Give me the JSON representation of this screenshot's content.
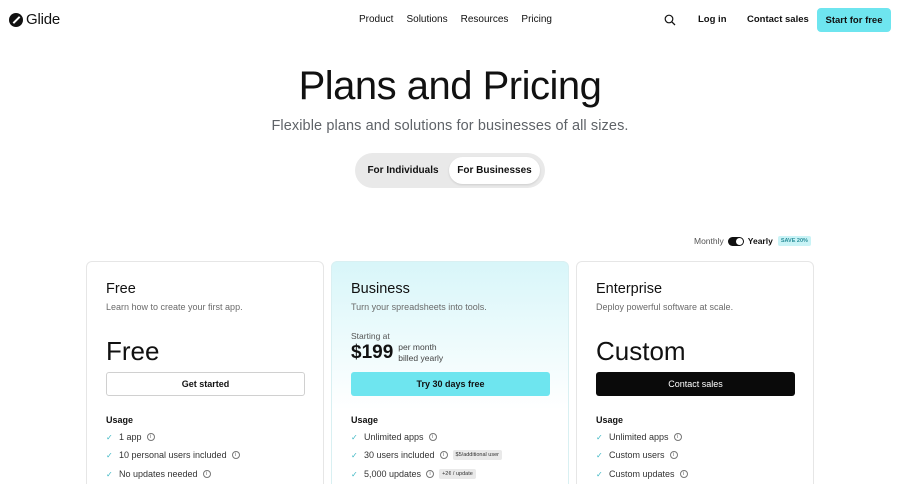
{
  "brand": {
    "name": "Glide"
  },
  "nav": {
    "links": [
      "Product",
      "Solutions",
      "Resources",
      "Pricing"
    ],
    "login": "Log in",
    "contact": "Contact sales",
    "cta": "Start for free"
  },
  "hero": {
    "title": "Plans and Pricing",
    "subtitle": "Flexible plans and solutions for businesses of all sizes."
  },
  "segment": {
    "individuals": "For Individuals",
    "businesses": "For Businesses",
    "selected": "For Businesses"
  },
  "billing": {
    "monthly": "Monthly",
    "yearly": "Yearly",
    "save": "SAVE 20%",
    "selected": "Yearly"
  },
  "plans": [
    {
      "name": "Free",
      "desc": "Learn how to create your first app.",
      "price": "Free",
      "cta": "Get started",
      "usage_label": "Usage",
      "features": [
        {
          "text": "1 app",
          "tag": ""
        },
        {
          "text": "10 personal users included",
          "tag": ""
        },
        {
          "text": "No updates needed",
          "tag": ""
        }
      ]
    },
    {
      "name": "Business",
      "desc": "Turn your spreadsheets into tools.",
      "starting": "Starting at",
      "price": "$199",
      "per_line1": "per month",
      "per_line2": "billed yearly",
      "cta": "Try 30 days free",
      "usage_label": "Usage",
      "features": [
        {
          "text": "Unlimited apps",
          "tag": ""
        },
        {
          "text": "30 users included",
          "tag": "$5/additional user"
        },
        {
          "text": "5,000 updates",
          "tag": "+2¢ / update"
        }
      ]
    },
    {
      "name": "Enterprise",
      "desc": "Deploy powerful software at scale.",
      "price": "Custom",
      "cta": "Contact sales",
      "usage_label": "Usage",
      "features": [
        {
          "text": "Unlimited apps",
          "tag": ""
        },
        {
          "text": "Custom users",
          "tag": ""
        },
        {
          "text": "Custom updates",
          "tag": ""
        }
      ]
    }
  ],
  "icons": {
    "search": "search-icon",
    "check": "check-icon",
    "info": "info-icon"
  },
  "colors": {
    "accent": "#6ee5ef",
    "dark": "#0a0a0a",
    "save_badge_bg": "#c9f3f6"
  }
}
